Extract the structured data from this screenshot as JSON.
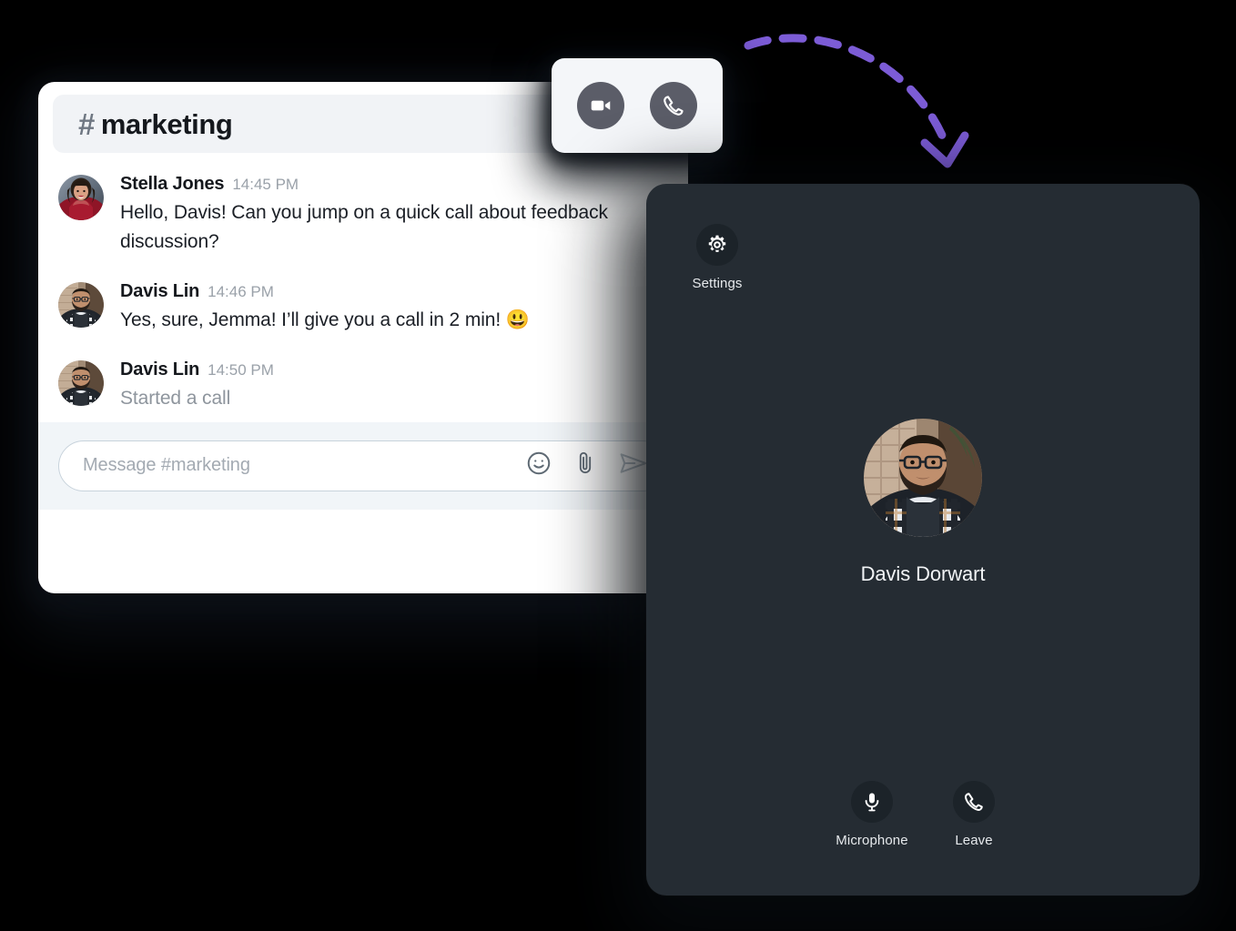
{
  "background_color": "#000000",
  "chat": {
    "header": {
      "hash": "#",
      "channel": "marketing"
    },
    "messages": [
      {
        "author": "Stella Jones",
        "time": "14:45 PM",
        "text": "Hello, Davis! Can you jump on a quick call about feedback discussion?",
        "avatar_name": "avatar-stella-jones",
        "muted": false,
        "emoji": ""
      },
      {
        "author": "Davis Lin",
        "time": "14:46 PM",
        "text": "Yes, sure, Jemma! I’ll give you a call in 2 min!",
        "avatar_name": "avatar-davis-lin",
        "muted": false,
        "emoji": "😃"
      },
      {
        "author": "Davis Lin",
        "time": "14:50 PM",
        "text": "Started a call",
        "avatar_name": "avatar-davis-lin",
        "muted": true,
        "emoji": ""
      }
    ],
    "composer": {
      "placeholder": "Message #marketing",
      "icons": [
        "emoji-icon",
        "attachment-icon",
        "send-icon"
      ]
    }
  },
  "call_actions": {
    "buttons": [
      {
        "name": "video-call-button",
        "icon": "video-camera-icon"
      },
      {
        "name": "audio-call-button",
        "icon": "phone-icon"
      }
    ],
    "button_color": "#5b5d68",
    "panel_color": "#f4f6f9"
  },
  "call_panel": {
    "background_color": "#252c33",
    "settings": {
      "label": "Settings",
      "icon": "gear-icon"
    },
    "participant": {
      "name": "Davis Dorwart",
      "avatar_name": "avatar-davis-dorwart"
    },
    "controls": [
      {
        "label": "Microphone",
        "icon": "microphone-icon",
        "name": "microphone-button"
      },
      {
        "label": "Leave",
        "icon": "phone-hangup-icon",
        "name": "leave-button"
      }
    ]
  },
  "annotation_arrow": {
    "color": "#7c5cd6",
    "style": "dashed-curved-arrow",
    "direction": "from-call-actions-to-call-panel"
  }
}
